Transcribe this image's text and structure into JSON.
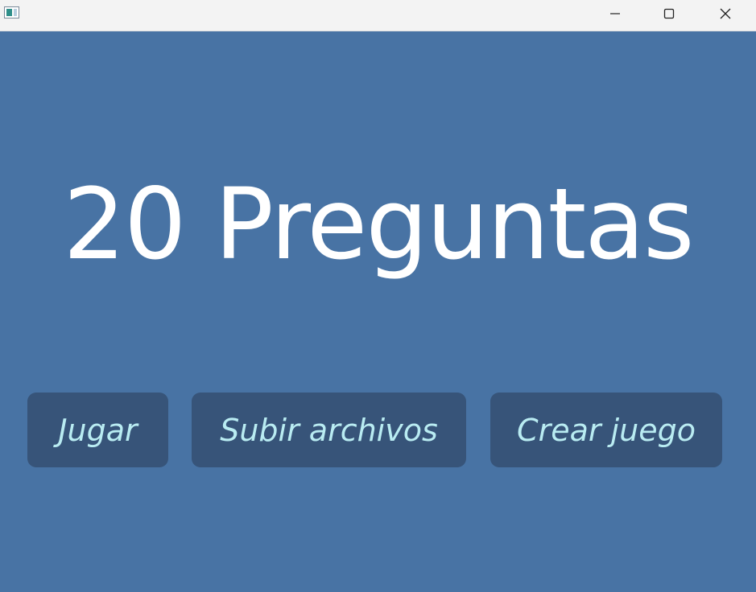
{
  "window": {
    "icon": "app-window-icon",
    "controls": {
      "minimize_icon": "minimize-icon",
      "maximize_icon": "maximize-icon",
      "close_icon": "close-icon"
    }
  },
  "main": {
    "title": "20 Preguntas",
    "buttons": {
      "jugar": "Jugar",
      "subir": "Subir archivos",
      "crear": "Crear juego"
    }
  },
  "colors": {
    "background": "#4873a4",
    "button_bg": "#375479",
    "button_text": "#b9ecf2",
    "title_text": "#ffffff",
    "titlebar_bg": "#f3f3f3"
  }
}
